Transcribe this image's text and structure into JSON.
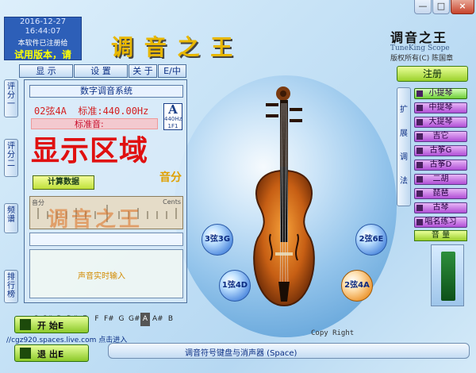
{
  "window": {
    "minimize": "—",
    "maximize": "□",
    "close": "×"
  },
  "info": {
    "date": "2016-12-27",
    "time": "16:44:07",
    "registered": "本软件已注册给",
    "trial": "试用版本，请"
  },
  "app_title": "调 音 之 王",
  "logo": {
    "name": "调音之王",
    "sub": "TuneKing Scope",
    "copyright": "版权所有(C) 陈国章"
  },
  "tabs": [
    "显 示",
    "设 置",
    "关 于",
    "E/中"
  ],
  "register_button": "注册",
  "panel": {
    "title": "数字调音系统",
    "string_info": "02弦4A  标准:440.00Hz",
    "std_note_label": "标准音:",
    "display_area": "显示区域",
    "cents": "音分",
    "calc_button": "计算数据",
    "note_a": "A",
    "note_a_hz": "440Hz",
    "note_a_sub": "1F1",
    "meter_left": "音分",
    "meter_right": "Cents",
    "meter_overlay": "调音之王",
    "notes": [
      "C",
      "C#",
      "D",
      "D#",
      "E",
      "F",
      "F#",
      "G",
      "G#",
      "A",
      "A#",
      "B"
    ],
    "selected_note": "A",
    "input_label": "声音实时输入"
  },
  "side_tabs": [
    "评分一",
    "评分二",
    "频谱",
    "排行榜"
  ],
  "extension": {
    "label": "扩展调法"
  },
  "instruments": [
    "小提琴",
    "中提琴",
    "大提琴",
    "吉它",
    "古筝G",
    "古筝D",
    "二胡",
    "琵琶",
    "古琴",
    "唱名练习"
  ],
  "volume": "音 量",
  "strings": {
    "s3": "3弦3G",
    "s2": "2弦6E",
    "s1": "1弦4D",
    "s0": "2弦4A"
  },
  "copyright_bottom": "Copy Right",
  "buttons": {
    "start": "开 始E",
    "exit": "退 出E"
  },
  "link": "//cgz920.spaces.live.com 点击进入",
  "status": "调音符号键盘与消声器 (Space)"
}
